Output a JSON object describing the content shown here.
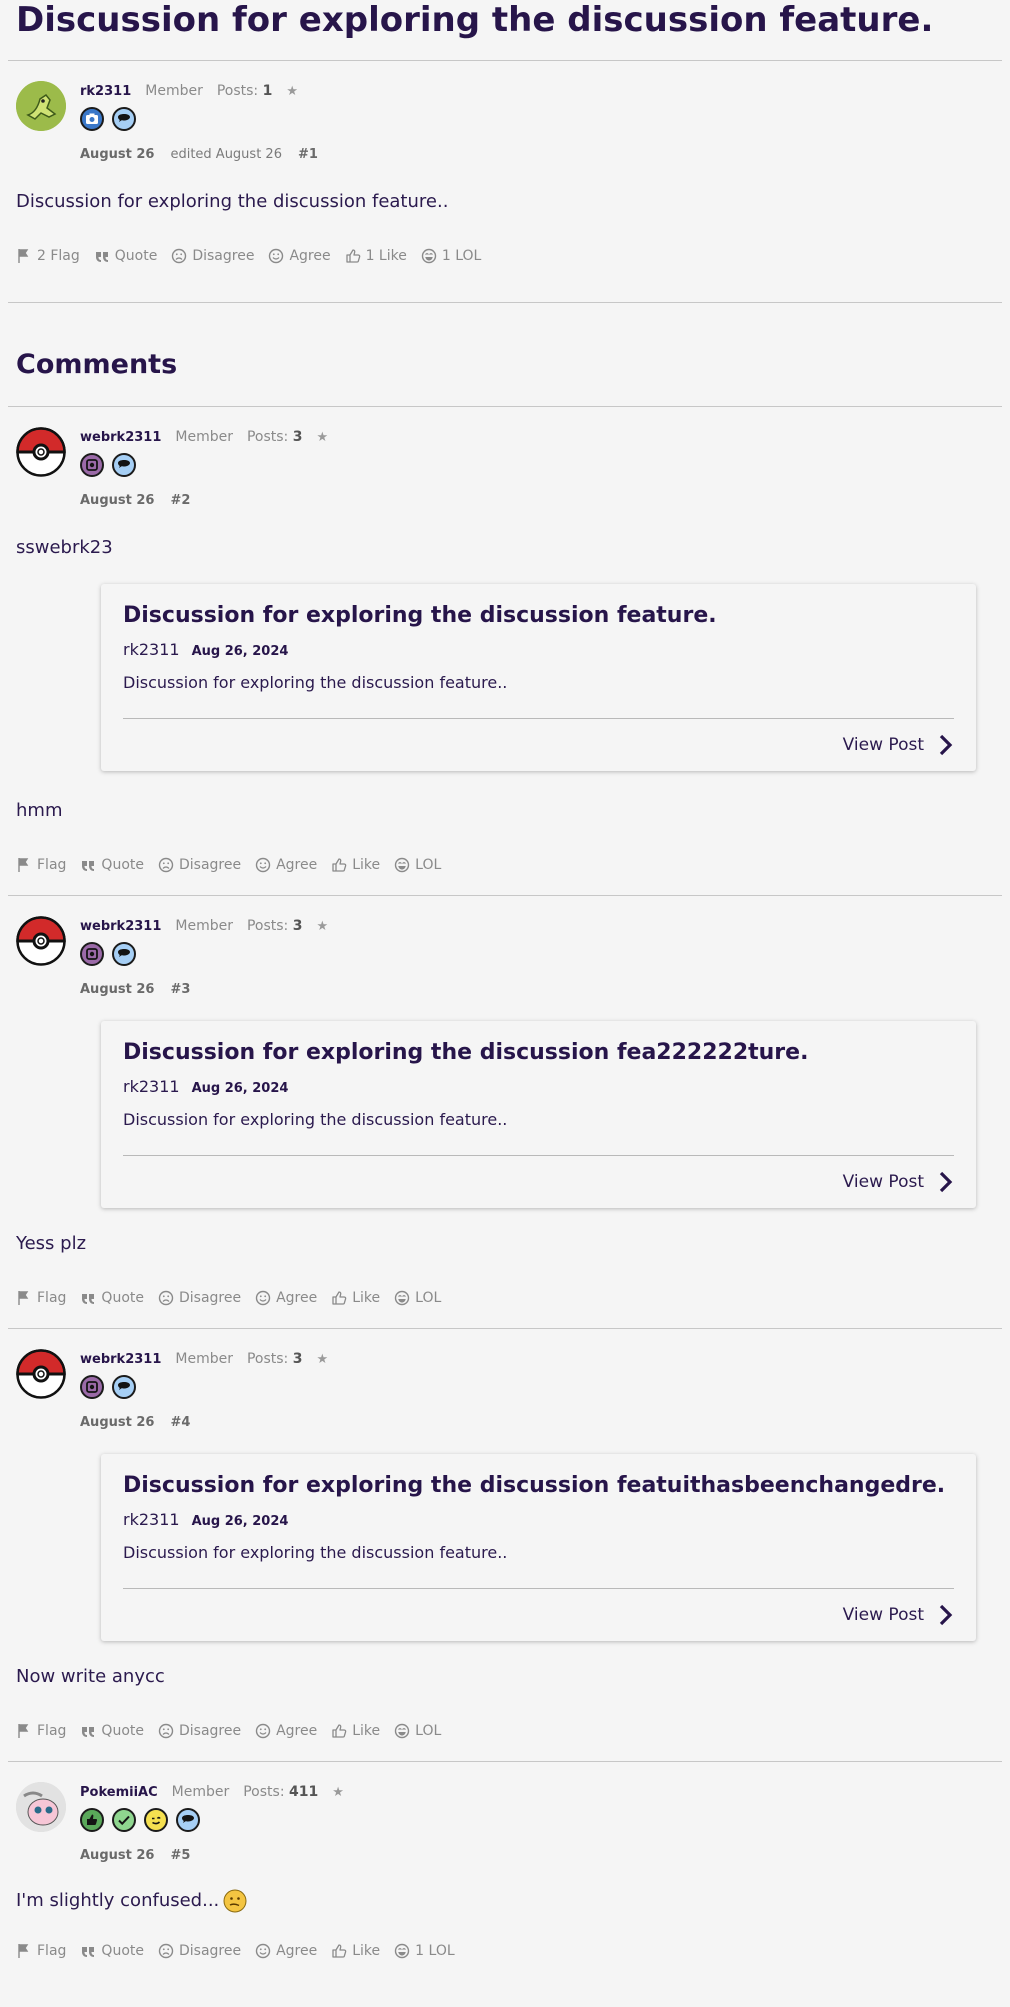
{
  "title": "Discussion for exploring the discussion feature.",
  "comments_heading": "Comments",
  "op": {
    "username": "rk2311",
    "role": "Member",
    "posts_label": "Posts:",
    "posts": "1",
    "date": "August 26",
    "edited": "edited August 26",
    "num": "#1",
    "body": "Discussion for exploring the discussion feature..",
    "actions": {
      "flag": "2 Flag",
      "quote": "Quote",
      "disagree": "Disagree",
      "agree": "Agree",
      "like": "1 Like",
      "lol": "1 LOL"
    }
  },
  "comments": [
    {
      "username": "webrk2311",
      "role": "Member",
      "posts_label": "Posts:",
      "posts": "3",
      "date": "August 26",
      "num": "#2",
      "pre_text": "sswebrk23",
      "embed": {
        "title": "Discussion for exploring the discussion feature.",
        "author": "rk2311",
        "date": "Aug 26, 2024",
        "body": "Discussion for exploring the discussion feature..",
        "view": "View Post"
      },
      "post_text": "hmm",
      "actions": {
        "flag": "Flag",
        "quote": "Quote",
        "disagree": "Disagree",
        "agree": "Agree",
        "like": "Like",
        "lol": "LOL"
      }
    },
    {
      "username": "webrk2311",
      "role": "Member",
      "posts_label": "Posts:",
      "posts": "3",
      "date": "August 26",
      "num": "#3",
      "embed": {
        "title": "Discussion for exploring the discussion fea222222ture.",
        "author": "rk2311",
        "date": "Aug 26, 2024",
        "body": "Discussion for exploring the discussion feature..",
        "view": "View Post"
      },
      "post_text": "Yess plz",
      "actions": {
        "flag": "Flag",
        "quote": "Quote",
        "disagree": "Disagree",
        "agree": "Agree",
        "like": "Like",
        "lol": "LOL"
      }
    },
    {
      "username": "webrk2311",
      "role": "Member",
      "posts_label": "Posts:",
      "posts": "3",
      "date": "August 26",
      "num": "#4",
      "embed": {
        "title": "Discussion for exploring the discussion featuithasbeenchangedre.",
        "author": "rk2311",
        "date": "Aug 26, 2024",
        "body": "Discussion for exploring the discussion feature..",
        "view": "View Post"
      },
      "post_text": "Now write anycc",
      "actions": {
        "flag": "Flag",
        "quote": "Quote",
        "disagree": "Disagree",
        "agree": "Agree",
        "like": "Like",
        "lol": "LOL"
      }
    },
    {
      "username": "PokemiiAC",
      "role": "Member",
      "posts_label": "Posts:",
      "posts": "411",
      "date": "August 26",
      "num": "#5",
      "post_text": "I'm slightly confused...",
      "actions": {
        "flag": "Flag",
        "quote": "Quote",
        "disagree": "Disagree",
        "agree": "Agree",
        "like": "Like",
        "lol": "1 LOL"
      }
    }
  ],
  "colors": {
    "heading": "#27154a",
    "text": "#2b1a4e",
    "muted": "#8a8a8a",
    "background": "#f5f5f5"
  }
}
